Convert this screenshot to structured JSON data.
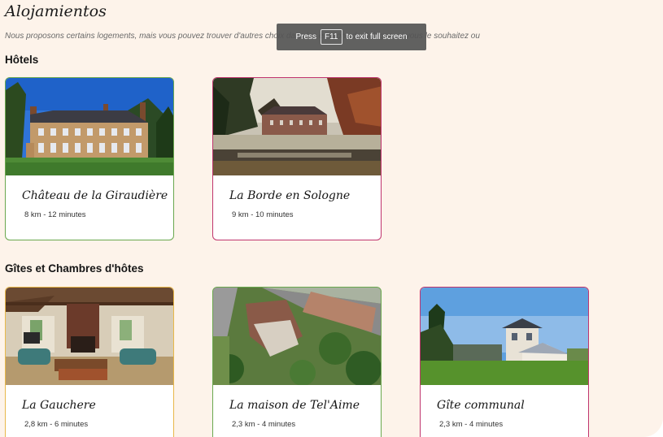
{
  "page": {
    "title": "Alojamientos",
    "intro": "Nous proposons certains logements, mais vous pouvez trouver d'autres choix dans les environs de Sologne, si vous le souhaitez ou"
  },
  "toast": {
    "press": "Press",
    "key": "F11",
    "message": "to exit full screen"
  },
  "sections": {
    "hotels": {
      "title": "Hôtels",
      "items": [
        {
          "name": "Château de la Giraudière",
          "distance": "8 km - 12 minutes",
          "image": "chateau-photo",
          "border": "#6aa84f"
        },
        {
          "name": "La Borde en Sologne",
          "distance": "9 km - 10 minutes",
          "image": "manor-photo",
          "border": "#c0356e"
        }
      ]
    },
    "gites": {
      "title": "Gîtes et Chambres d'hôtes",
      "items": [
        {
          "name": "La Gauchere",
          "distance": "2,8 km - 6 minutes",
          "image": "living-room-photo",
          "border": "#e8b84a"
        },
        {
          "name": "La maison de Tel'Aime",
          "distance": "2,3 km - 4 minutes",
          "image": "aerial-house-photo",
          "border": "#6aa84f"
        },
        {
          "name": "Gîte communal",
          "distance": "2,3 km - 4 minutes",
          "image": "villa-photo",
          "border": "#c0356e"
        }
      ]
    }
  }
}
